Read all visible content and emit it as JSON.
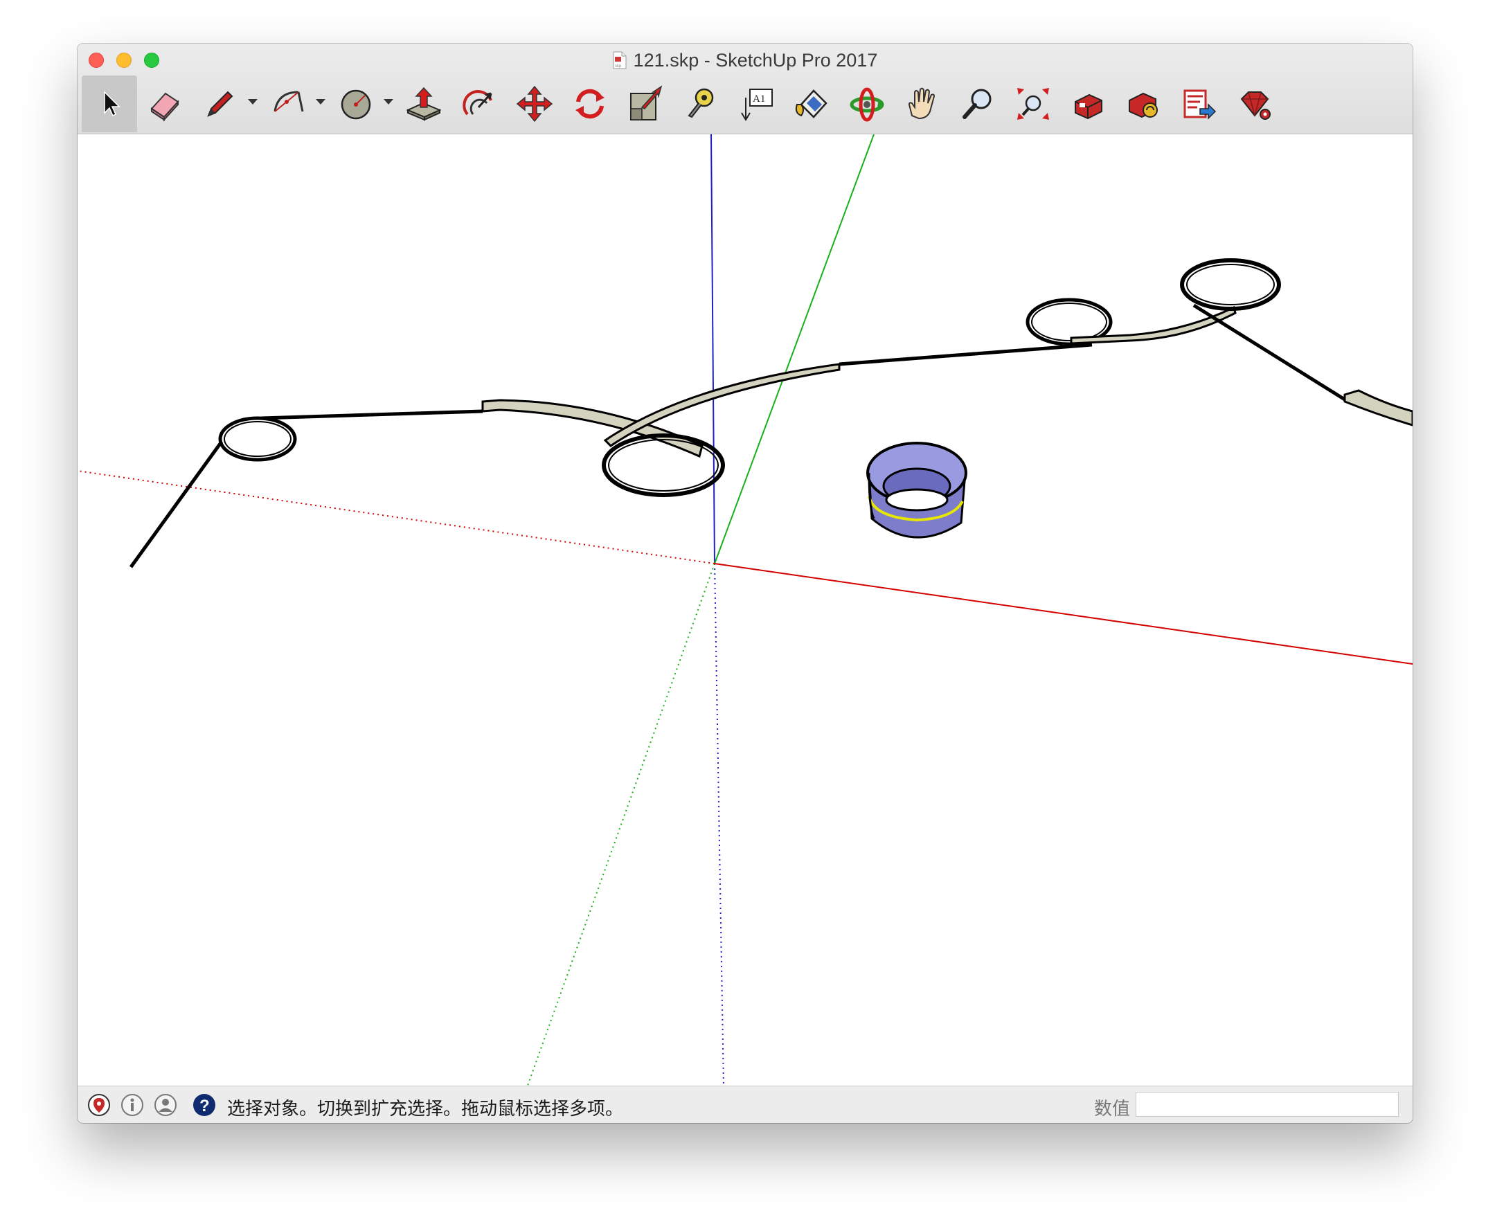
{
  "window": {
    "title": "121.skp - SketchUp Pro 2017",
    "doc_icon_label": "skp"
  },
  "toolbar": {
    "items": [
      {
        "name": "select-tool",
        "icon": "arrow-cursor-icon",
        "active": true
      },
      {
        "name": "eraser-tool",
        "icon": "eraser-icon"
      },
      {
        "name": "line-tool",
        "icon": "pencil-icon",
        "dropdown": true
      },
      {
        "name": "arc-tool",
        "icon": "arc-icon",
        "dropdown": true
      },
      {
        "name": "shapes-tool",
        "icon": "circle-shape-icon",
        "dropdown": true
      },
      {
        "name": "push-pull-tool",
        "icon": "push-pull-icon"
      },
      {
        "name": "offset-tool",
        "icon": "offset-icon"
      },
      {
        "name": "move-tool",
        "icon": "move-arrows-icon"
      },
      {
        "name": "rotate-tool",
        "icon": "rotate-icon"
      },
      {
        "name": "scale-tool",
        "icon": "scale-icon"
      },
      {
        "name": "tape-measure-tool",
        "icon": "tape-measure-icon"
      },
      {
        "name": "text-tool",
        "icon": "text-label-icon",
        "label": "A1"
      },
      {
        "name": "paint-bucket-tool",
        "icon": "paint-bucket-icon"
      },
      {
        "name": "orbit-tool",
        "icon": "orbit-icon"
      },
      {
        "name": "pan-tool",
        "icon": "hand-icon"
      },
      {
        "name": "zoom-tool",
        "icon": "magnifier-icon"
      },
      {
        "name": "zoom-extents-tool",
        "icon": "zoom-extents-icon"
      },
      {
        "name": "3d-warehouse-tool",
        "icon": "warehouse-icon"
      },
      {
        "name": "extension-warehouse-tool",
        "icon": "extension-warehouse-icon"
      },
      {
        "name": "send-to-layout-tool",
        "icon": "layout-icon"
      },
      {
        "name": "ruby-console-tool",
        "icon": "ruby-gem-icon"
      }
    ]
  },
  "colors": {
    "x_axis": "#d40000",
    "y_axis": "#18b018",
    "z_axis": "#1a1ad6",
    "edge": "#000000",
    "face_tan": "#d4d3c0",
    "component_blue": "#8080cc",
    "selection_yellow": "#e6e600"
  },
  "statusbar": {
    "icons": [
      "geo-location-icon",
      "credits-icon",
      "user-account-icon",
      "help-icon"
    ],
    "text": "选择对象。切换到扩充选择。拖动鼠标选择多项。",
    "measurements_label": "数值",
    "measurements_value": ""
  }
}
